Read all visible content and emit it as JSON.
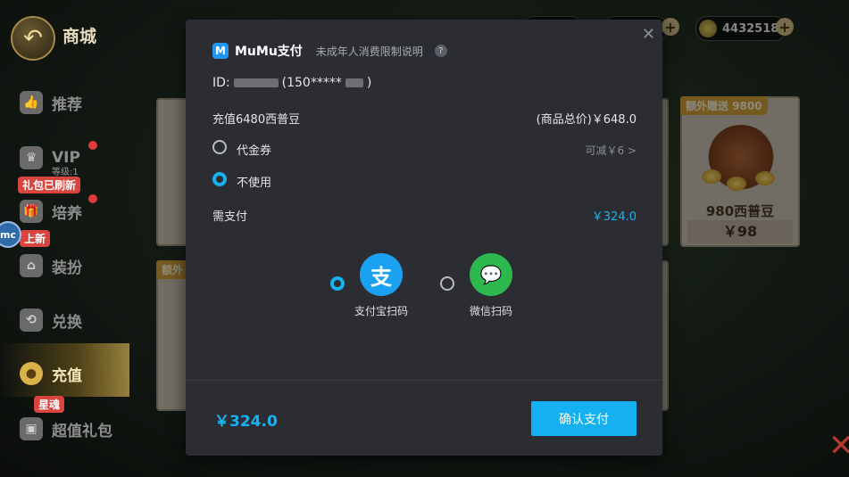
{
  "shop": {
    "title": "商城",
    "back_icon": "back-arrow-icon"
  },
  "currency": {
    "balance": "4432518"
  },
  "sidebar": {
    "items": [
      {
        "label": "推荐",
        "icon": "thumbs-up-icon"
      },
      {
        "label": "VIP",
        "sub": "等级:1",
        "icon": "crown-icon"
      },
      {
        "label": "培养",
        "icon": "gift-icon",
        "tag": "礼包已刷新"
      },
      {
        "label": "装扮",
        "icon": "shop-icon",
        "tag": "上新"
      },
      {
        "label": "兑换",
        "icon": "exchange-icon"
      },
      {
        "label": "充值",
        "icon": "bean-icon"
      },
      {
        "label": "超值礼包",
        "icon": "gift-box-icon",
        "tag": "星魂"
      }
    ]
  },
  "cards": {
    "right": {
      "ribbon": "额外赠送",
      "ribbon_value": "9800",
      "name": "980西普豆",
      "price": "￥98"
    },
    "left": {
      "ribbon": "额外"
    }
  },
  "payment": {
    "brand": "MuMu支付",
    "minor_note": "未成年人消费限制说明",
    "id_prefix": "ID:",
    "id_phone": "(150*****",
    "id_phone_end": ")",
    "product": "充值6480西普豆",
    "total_label": "(商品总价)￥648.0",
    "voucher_label": "代金券",
    "voucher_hint": "可减￥6 >",
    "no_use_label": "不使用",
    "need_pay_label": "需支付",
    "need_pay_value": "￥324.0",
    "methods": [
      {
        "label": "支付宝扫码",
        "icon": "alipay-icon",
        "glyph": "支",
        "selected": true,
        "color": "#1aa1f2"
      },
      {
        "label": "微信扫码",
        "icon": "wechat-icon",
        "glyph": "💬",
        "selected": false,
        "color": "#2db84d"
      }
    ],
    "amount": "￥324.0",
    "confirm_label": "确认支付",
    "close_icon": "close-icon"
  }
}
